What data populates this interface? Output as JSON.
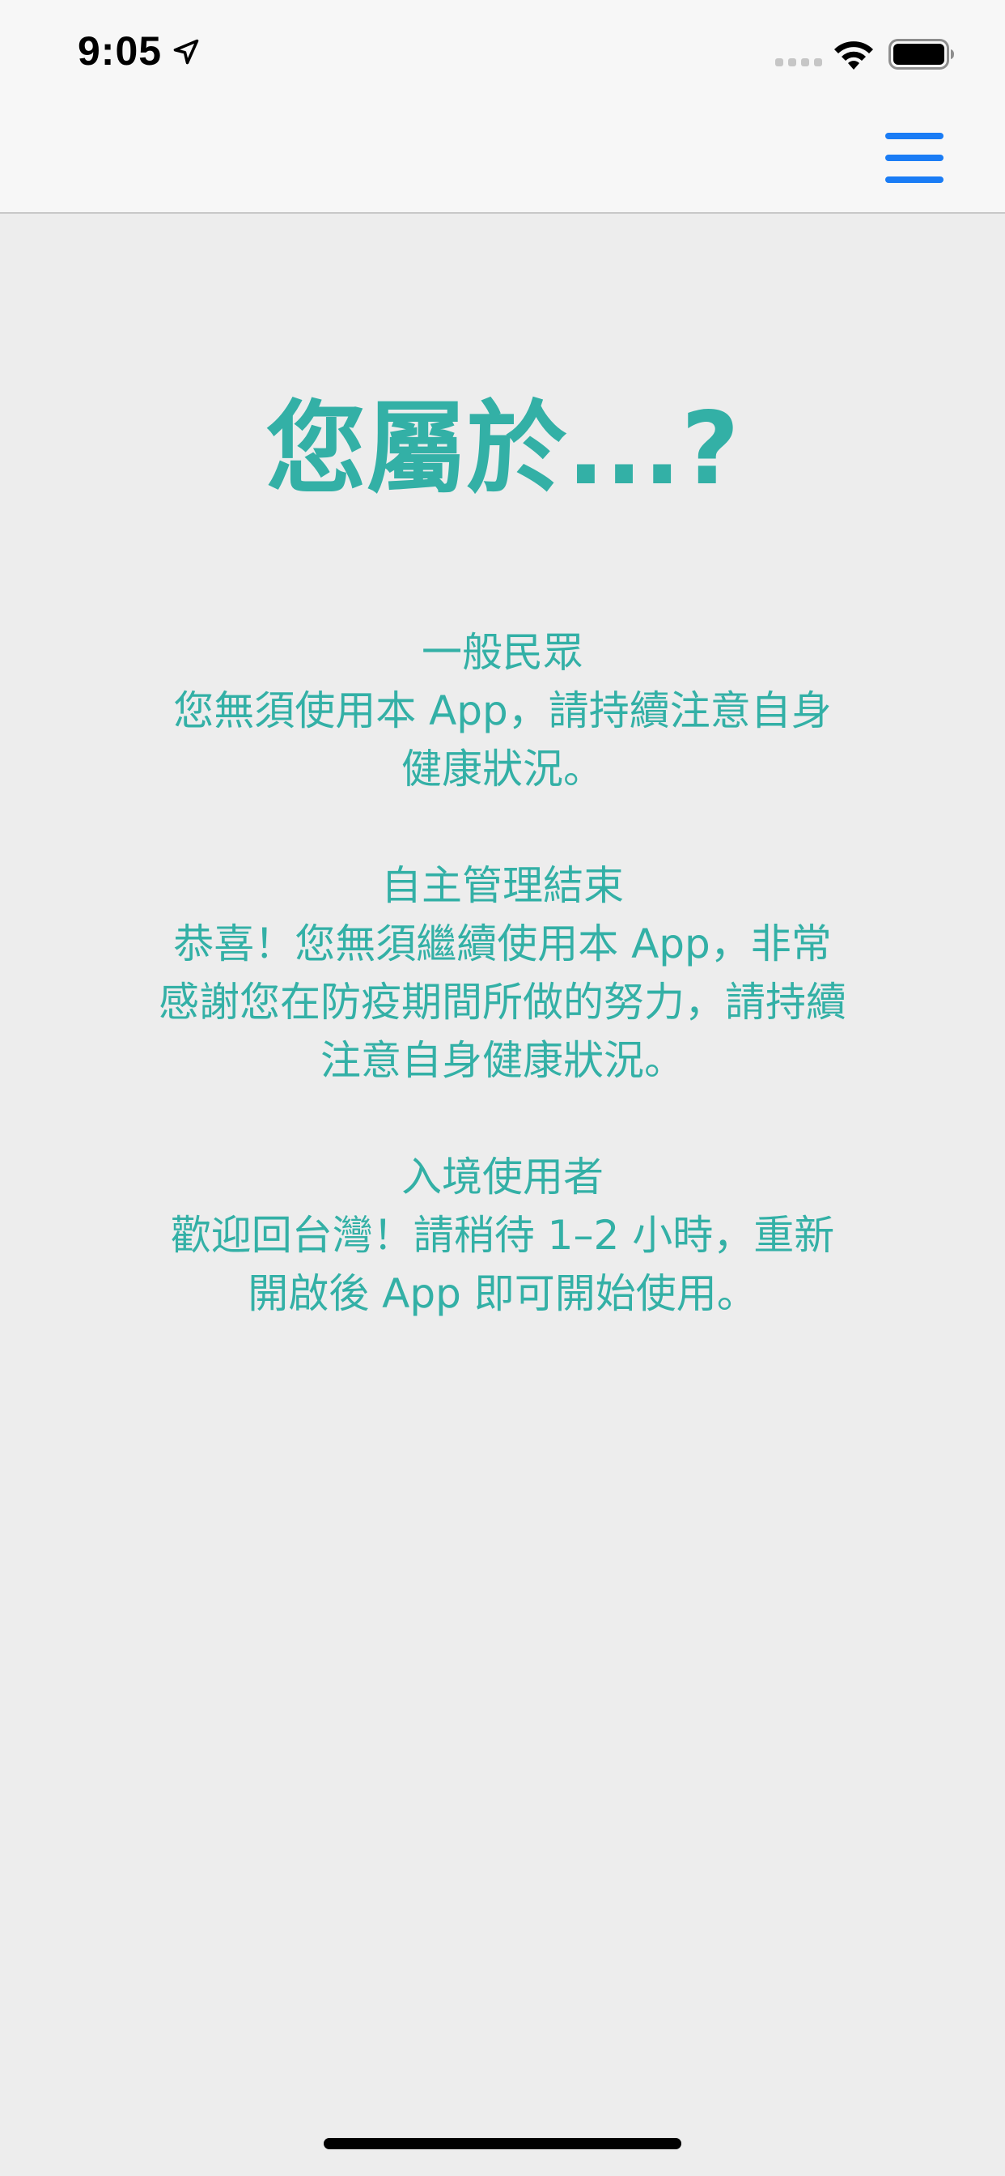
{
  "status_bar": {
    "time": "9:05",
    "icons": [
      "location-arrow-icon",
      "signal-icon",
      "wifi-icon",
      "battery-icon"
    ]
  },
  "nav": {
    "menu_icon": "hamburger-menu-icon",
    "accent_color": "#1a7cf5"
  },
  "main": {
    "heading": "您屬於...?",
    "accent_color": "#33b0a6",
    "sections": [
      {
        "title": "一般民眾",
        "description": "您無須使用本 App，請持續注意自身健康狀況。"
      },
      {
        "title": "自主管理結束",
        "description": "恭喜！您無須繼續使用本 App，非常感謝您在防疫期間所做的努力，請持續注意自身健康狀況。"
      },
      {
        "title": "入境使用者",
        "description": "歡迎回台灣！請稍待 1–2 小時，重新開啟後 App 即可開始使用。"
      }
    ]
  }
}
